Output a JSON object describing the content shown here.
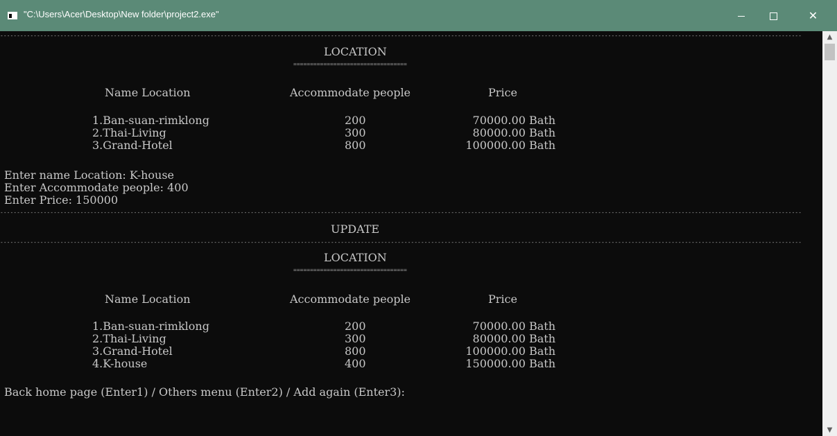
{
  "window": {
    "title": "\"C:\\Users\\Acer\\Desktop\\New folder\\project2.exe\""
  },
  "console": {
    "dash_line": "------------------------------------------------------------------------------------------------------------------------------------------------------------------------------------------------------------------------------------------------",
    "eq_line": "==================================",
    "section_title": "LOCATION",
    "update_title": "UPDATE",
    "headers": {
      "name": "Name Location",
      "people": "Accommodate people",
      "price": "Price"
    },
    "table_before": [
      {
        "name": "1.Ban-suan-rimklong",
        "people": "200",
        "price": "70000.00 Bath"
      },
      {
        "name": "2.Thai-Living",
        "people": "300",
        "price": "80000.00 Bath"
      },
      {
        "name": "3.Grand-Hotel",
        "people": "800",
        "price": "100000.00 Bath"
      }
    ],
    "prompts": [
      "Enter name Location: K-house",
      "Enter Accommodate people: 400",
      "Enter Price: 150000"
    ],
    "table_after": [
      {
        "name": "1.Ban-suan-rimklong",
        "people": "200",
        "price": "70000.00 Bath"
      },
      {
        "name": "2.Thai-Living",
        "people": "300",
        "price": "80000.00 Bath"
      },
      {
        "name": "3.Grand-Hotel",
        "people": "800",
        "price": "100000.00 Bath"
      },
      {
        "name": "4.K-house",
        "people": "400",
        "price": "150000.00 Bath"
      }
    ],
    "final_prompt": "Back home page (Enter1) / Others menu (Enter2) / Add again (Enter3):"
  },
  "icons": {
    "app": "console-app-icon",
    "minimize": "minimize-icon",
    "maximize": "maximize-icon",
    "close": "close-icon",
    "scroll_up": "scroll-up-arrow-icon",
    "scroll_down": "scroll-down-arrow-icon"
  },
  "colors": {
    "titlebar": "#5b8a77",
    "console_bg": "#0c0c0c",
    "console_text": "#c8c8c8"
  }
}
